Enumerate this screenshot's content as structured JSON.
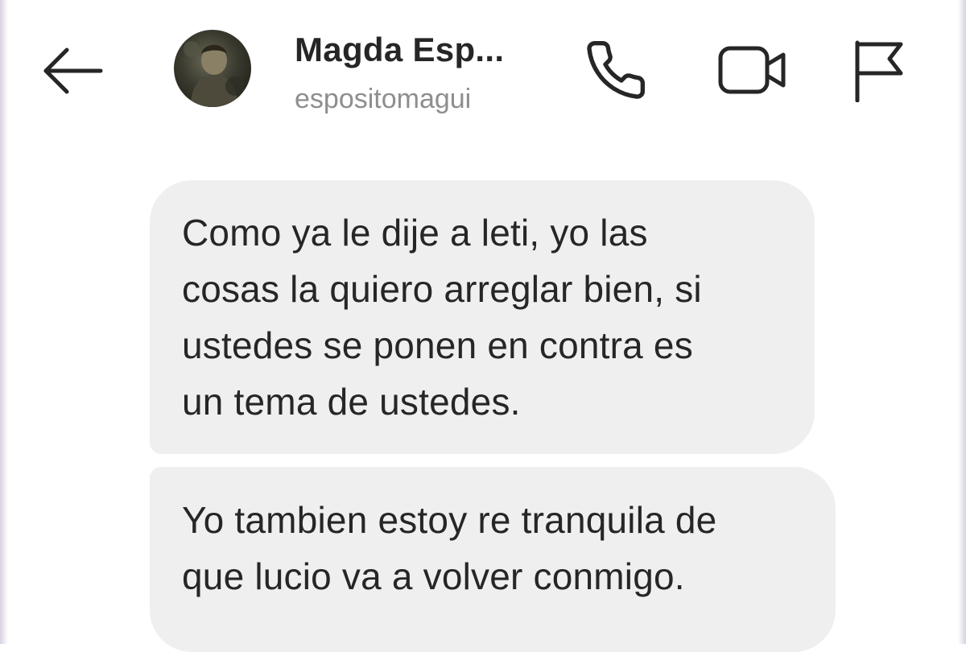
{
  "header": {
    "back_icon": "arrow-left-icon",
    "contact_name": "Magda Esp...",
    "contact_handle": "espositomagui",
    "actions": [
      {
        "name": "call",
        "icon": "phone-icon"
      },
      {
        "name": "video",
        "icon": "video-camera-icon"
      },
      {
        "name": "report",
        "icon": "flag-icon"
      }
    ]
  },
  "messages": [
    {
      "lines": [
        "Como ya le dije a leti, yo las",
        "cosas la quiero arreglar bien, si",
        "ustedes se ponen en contra es",
        "un tema de ustedes."
      ]
    },
    {
      "lines": [
        "Yo tambien estoy re tranquila de",
        "que lucio va a volver conmigo."
      ]
    }
  ],
  "colors": {
    "bubble": "#efefef",
    "text": "#262626",
    "secondary_text": "#8e8e8e",
    "icon": "#262626",
    "background": "#ffffff"
  }
}
